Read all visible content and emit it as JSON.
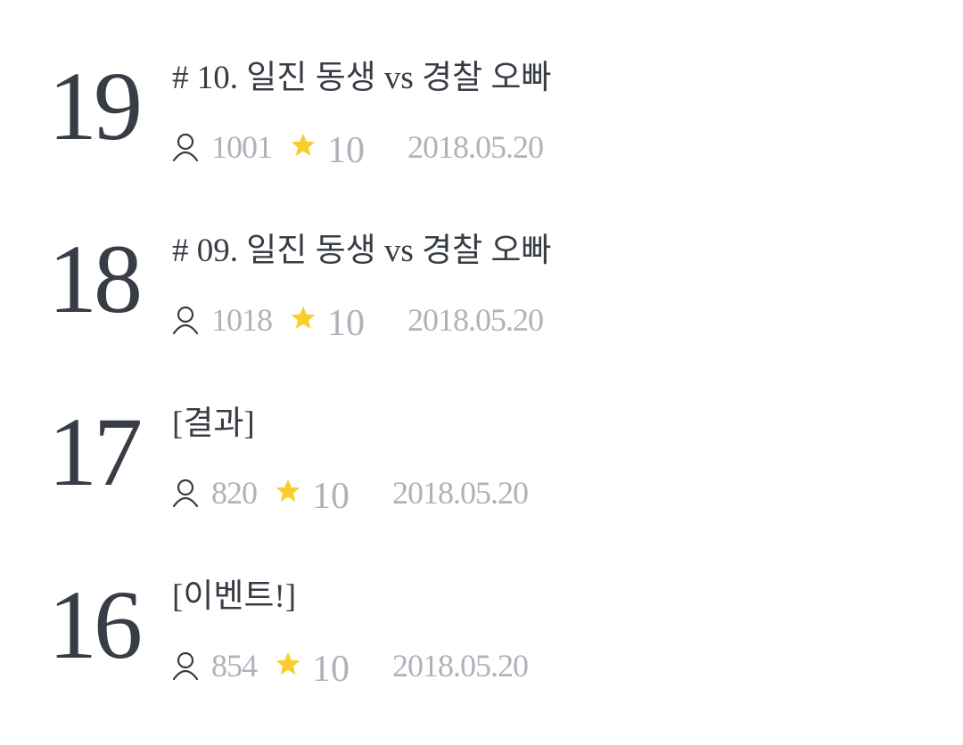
{
  "episodes": [
    {
      "number": "19",
      "title": "# 10. 일진 동생 vs 경찰 오빠",
      "views": "1001",
      "rating": "10",
      "date": "2018.05.20",
      "views_icon": "user-icon",
      "rating_icon": "star-icon"
    },
    {
      "number": "18",
      "title": "# 09. 일진 동생 vs 경찰 오빠",
      "views": "1018",
      "rating": "10",
      "date": "2018.05.20",
      "views_icon": "user-icon",
      "rating_icon": "star-icon"
    },
    {
      "number": "17",
      "title": "[결과]",
      "views": "820",
      "rating": "10",
      "date": "2018.05.20",
      "views_icon": "user-icon",
      "rating_icon": "star-icon"
    },
    {
      "number": "16",
      "title": "[이벤트!]",
      "views": "854",
      "rating": "10",
      "date": "2018.05.20",
      "views_icon": "user-icon",
      "rating_icon": "star-icon"
    }
  ],
  "colors": {
    "primary_text": "#383c44",
    "secondary_text": "#aeb3ba",
    "star": "#f8cd2c",
    "background": "#ffffff"
  }
}
